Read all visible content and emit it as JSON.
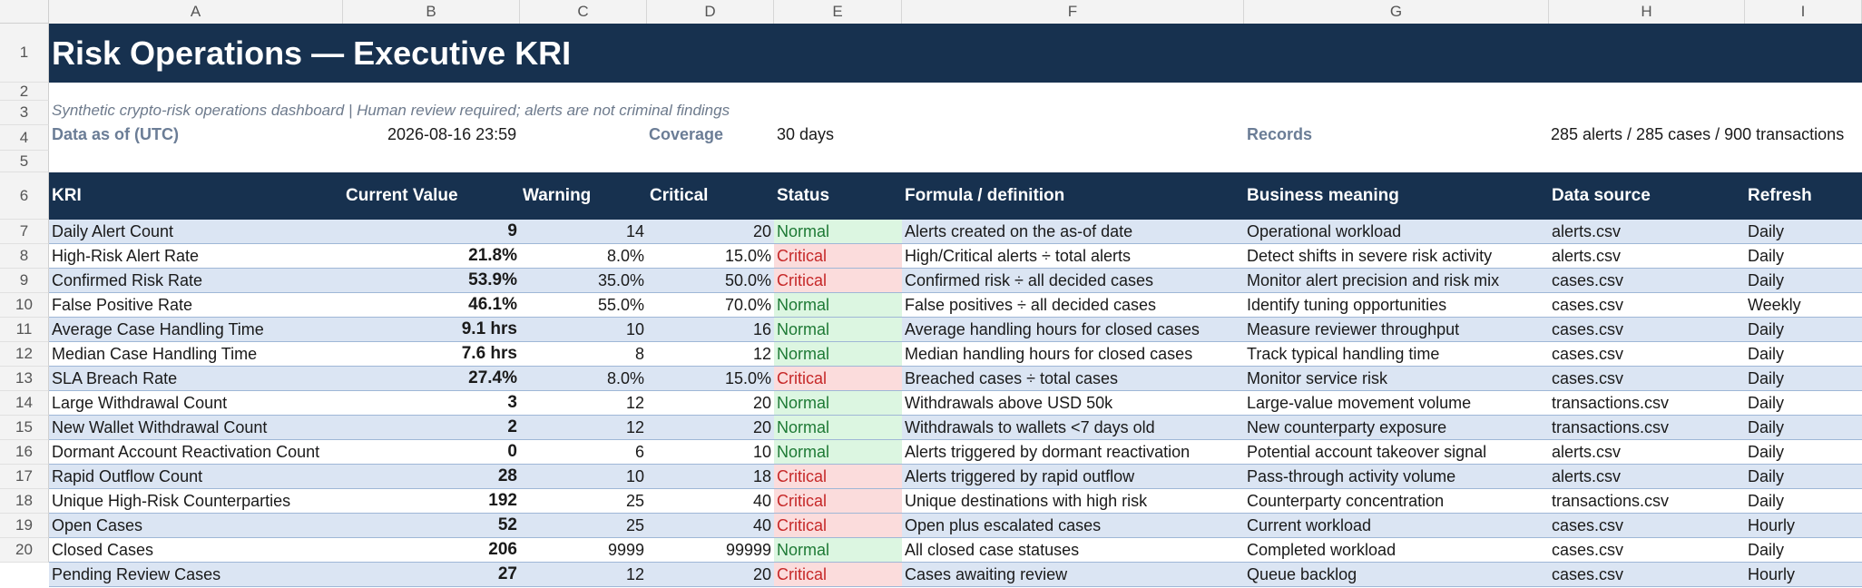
{
  "columns": [
    "A",
    "B",
    "C",
    "D",
    "E",
    "F",
    "G",
    "H",
    "I"
  ],
  "row_numbers": [
    "1",
    "2",
    "3",
    "4",
    "5",
    "6",
    "7",
    "8",
    "9",
    "10",
    "11",
    "12",
    "13",
    "14",
    "15",
    "16",
    "17",
    "18",
    "19",
    "20"
  ],
  "title": "Risk Operations — Executive KRI",
  "subtitle": "Synthetic crypto-risk operations dashboard | Human review required; alerts are not criminal findings",
  "meta": {
    "data_as_of_label": "Data as of (UTC)",
    "data_as_of_value": "2026-08-16 23:59",
    "coverage_label": "Coverage",
    "coverage_value": "30 days",
    "records_label": "Records",
    "records_value": "285 alerts / 285 cases / 900 transactions"
  },
  "headers": [
    "KRI",
    "Current Value",
    "Warning",
    "Critical",
    "Status",
    "Formula / definition",
    "Business meaning",
    "Data source",
    "Refresh"
  ],
  "status_colors": {
    "Normal": "#1e7a35",
    "Critical": "#c62828",
    "Normal_bg": "#dcf6e1",
    "Critical_bg": "#fbdcdc"
  },
  "rows": [
    {
      "kri": "Daily Alert Count",
      "current": "9",
      "warning": "14",
      "critical": "20",
      "status": "Normal",
      "formula": "Alerts created on the as-of date",
      "meaning": "Operational workload",
      "source": "alerts.csv",
      "refresh": "Daily"
    },
    {
      "kri": "High-Risk Alert Rate",
      "current": "21.8%",
      "warning": "8.0%",
      "critical": "15.0%",
      "status": "Critical",
      "formula": "High/Critical alerts ÷ total alerts",
      "meaning": "Detect shifts in severe risk activity",
      "source": "alerts.csv",
      "refresh": "Daily"
    },
    {
      "kri": "Confirmed Risk Rate",
      "current": "53.9%",
      "warning": "35.0%",
      "critical": "50.0%",
      "status": "Critical",
      "formula": "Confirmed risk ÷ all decided cases",
      "meaning": "Monitor alert precision and risk mix",
      "source": "cases.csv",
      "refresh": "Daily"
    },
    {
      "kri": "False Positive Rate",
      "current": "46.1%",
      "warning": "55.0%",
      "critical": "70.0%",
      "status": "Normal",
      "formula": "False positives ÷ all decided cases",
      "meaning": "Identify tuning opportunities",
      "source": "cases.csv",
      "refresh": "Weekly"
    },
    {
      "kri": "Average Case Handling Time",
      "current": "9.1 hrs",
      "warning": "10",
      "critical": "16",
      "status": "Normal",
      "formula": "Average handling hours for closed cases",
      "meaning": "Measure reviewer throughput",
      "source": "cases.csv",
      "refresh": "Daily"
    },
    {
      "kri": "Median Case Handling Time",
      "current": "7.6 hrs",
      "warning": "8",
      "critical": "12",
      "status": "Normal",
      "formula": "Median handling hours for closed cases",
      "meaning": "Track typical handling time",
      "source": "cases.csv",
      "refresh": "Daily"
    },
    {
      "kri": "SLA Breach Rate",
      "current": "27.4%",
      "warning": "8.0%",
      "critical": "15.0%",
      "status": "Critical",
      "formula": "Breached cases ÷ total cases",
      "meaning": "Monitor service risk",
      "source": "cases.csv",
      "refresh": "Daily"
    },
    {
      "kri": "Large Withdrawal Count",
      "current": "3",
      "warning": "12",
      "critical": "20",
      "status": "Normal",
      "formula": "Withdrawals above USD 50k",
      "meaning": "Large-value movement volume",
      "source": "transactions.csv",
      "refresh": "Daily"
    },
    {
      "kri": "New Wallet Withdrawal Count",
      "current": "2",
      "warning": "12",
      "critical": "20",
      "status": "Normal",
      "formula": "Withdrawals to wallets <7 days old",
      "meaning": "New counterparty exposure",
      "source": "transactions.csv",
      "refresh": "Daily"
    },
    {
      "kri": "Dormant Account Reactivation Count",
      "current": "0",
      "warning": "6",
      "critical": "10",
      "status": "Normal",
      "formula": "Alerts triggered by dormant reactivation",
      "meaning": "Potential account takeover signal",
      "source": "alerts.csv",
      "refresh": "Daily"
    },
    {
      "kri": "Rapid Outflow Count",
      "current": "28",
      "warning": "10",
      "critical": "18",
      "status": "Critical",
      "formula": "Alerts triggered by rapid outflow",
      "meaning": "Pass-through activity volume",
      "source": "alerts.csv",
      "refresh": "Daily"
    },
    {
      "kri": "Unique High-Risk Counterparties",
      "current": "192",
      "warning": "25",
      "critical": "40",
      "status": "Critical",
      "formula": "Unique destinations with high risk",
      "meaning": "Counterparty concentration",
      "source": "transactions.csv",
      "refresh": "Daily"
    },
    {
      "kri": "Open Cases",
      "current": "52",
      "warning": "25",
      "critical": "40",
      "status": "Critical",
      "formula": "Open plus escalated cases",
      "meaning": "Current workload",
      "source": "cases.csv",
      "refresh": "Hourly"
    },
    {
      "kri": "Closed Cases",
      "current": "206",
      "warning": "9999",
      "critical": "99999",
      "status": "Normal",
      "formula": "All closed case statuses",
      "meaning": "Completed workload",
      "source": "cases.csv",
      "refresh": "Daily"
    },
    {
      "kri": "Pending Review Cases",
      "current": "27",
      "warning": "12",
      "critical": "20",
      "status": "Critical",
      "formula": "Cases awaiting review",
      "meaning": "Queue backlog",
      "source": "cases.csv",
      "refresh": "Hourly"
    }
  ]
}
